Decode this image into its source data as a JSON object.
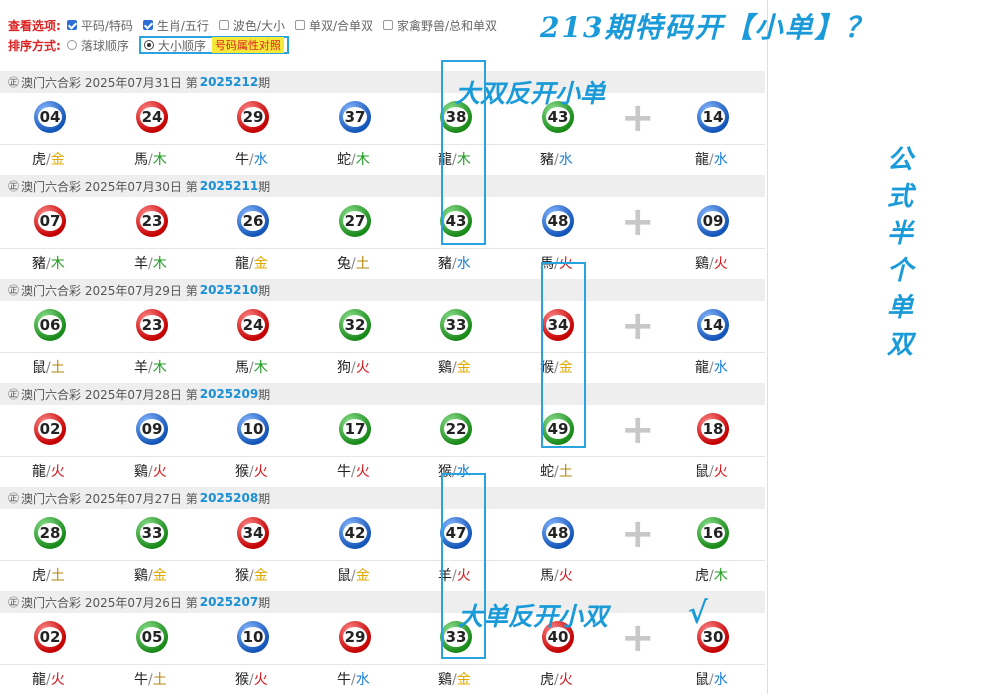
{
  "options": {
    "label": "查看选项:",
    "items": [
      {
        "label": "平码/特码",
        "checked": true
      },
      {
        "label": "生肖/五行",
        "checked": true
      },
      {
        "label": "波色/大小",
        "checked": false
      },
      {
        "label": "单双/合单双",
        "checked": false
      },
      {
        "label": "家禽野兽/总和单双",
        "checked": false
      }
    ]
  },
  "sort": {
    "label": "排序方式:",
    "items": [
      {
        "label": "落球顺序",
        "selected": false
      },
      {
        "label": "大小顺序",
        "selected": true
      }
    ],
    "attr_button": "号码属性对照"
  },
  "draws": [
    {
      "lottery": "澳门六合彩",
      "date": "2025年07月31日",
      "prefix": "第",
      "issue": "2025212",
      "suffix": "期",
      "balls": [
        {
          "n": "04",
          "c": "blue",
          "z": "虎",
          "e": "金",
          "ec": "gold"
        },
        {
          "n": "24",
          "c": "red",
          "z": "馬",
          "e": "木",
          "ec": "wood"
        },
        {
          "n": "29",
          "c": "red",
          "z": "牛",
          "e": "水",
          "ec": "water"
        },
        {
          "n": "37",
          "c": "blue",
          "z": "蛇",
          "e": "木",
          "ec": "wood"
        },
        {
          "n": "38",
          "c": "green",
          "z": "龍",
          "e": "木",
          "ec": "wood"
        },
        {
          "n": "43",
          "c": "green",
          "z": "豬",
          "e": "水",
          "ec": "water"
        }
      ],
      "special": {
        "n": "14",
        "c": "blue",
        "z": "龍",
        "e": "水",
        "ec": "water"
      }
    },
    {
      "lottery": "澳门六合彩",
      "date": "2025年07月30日",
      "prefix": "第",
      "issue": "2025211",
      "suffix": "期",
      "balls": [
        {
          "n": "07",
          "c": "red",
          "z": "豬",
          "e": "木",
          "ec": "wood"
        },
        {
          "n": "23",
          "c": "red",
          "z": "羊",
          "e": "木",
          "ec": "wood"
        },
        {
          "n": "26",
          "c": "blue",
          "z": "龍",
          "e": "金",
          "ec": "gold"
        },
        {
          "n": "27",
          "c": "green",
          "z": "兔",
          "e": "土",
          "ec": "earth"
        },
        {
          "n": "43",
          "c": "green",
          "z": "豬",
          "e": "水",
          "ec": "water"
        },
        {
          "n": "48",
          "c": "blue",
          "z": "馬",
          "e": "火",
          "ec": "fire"
        }
      ],
      "special": {
        "n": "09",
        "c": "blue",
        "z": "鷄",
        "e": "火",
        "ec": "fire"
      }
    },
    {
      "lottery": "澳门六合彩",
      "date": "2025年07月29日",
      "prefix": "第",
      "issue": "2025210",
      "suffix": "期",
      "balls": [
        {
          "n": "06",
          "c": "green",
          "z": "鼠",
          "e": "土",
          "ec": "earth"
        },
        {
          "n": "23",
          "c": "red",
          "z": "羊",
          "e": "木",
          "ec": "wood"
        },
        {
          "n": "24",
          "c": "red",
          "z": "馬",
          "e": "木",
          "ec": "wood"
        },
        {
          "n": "32",
          "c": "green",
          "z": "狗",
          "e": "火",
          "ec": "fire"
        },
        {
          "n": "33",
          "c": "green",
          "z": "鷄",
          "e": "金",
          "ec": "gold"
        },
        {
          "n": "34",
          "c": "red",
          "z": "猴",
          "e": "金",
          "ec": "gold"
        }
      ],
      "special": {
        "n": "14",
        "c": "blue",
        "z": "龍",
        "e": "水",
        "ec": "water"
      }
    },
    {
      "lottery": "澳门六合彩",
      "date": "2025年07月28日",
      "prefix": "第",
      "issue": "2025209",
      "suffix": "期",
      "balls": [
        {
          "n": "02",
          "c": "red",
          "z": "龍",
          "e": "火",
          "ec": "fire"
        },
        {
          "n": "09",
          "c": "blue",
          "z": "鷄",
          "e": "火",
          "ec": "fire"
        },
        {
          "n": "10",
          "c": "blue",
          "z": "猴",
          "e": "火",
          "ec": "fire"
        },
        {
          "n": "17",
          "c": "green",
          "z": "牛",
          "e": "火",
          "ec": "fire"
        },
        {
          "n": "22",
          "c": "green",
          "z": "猴",
          "e": "水",
          "ec": "water"
        },
        {
          "n": "49",
          "c": "green",
          "z": "蛇",
          "e": "土",
          "ec": "earth"
        }
      ],
      "special": {
        "n": "18",
        "c": "red",
        "z": "鼠",
        "e": "火",
        "ec": "fire"
      }
    },
    {
      "lottery": "澳门六合彩",
      "date": "2025年07月27日",
      "prefix": "第",
      "issue": "2025208",
      "suffix": "期",
      "balls": [
        {
          "n": "28",
          "c": "green",
          "z": "虎",
          "e": "土",
          "ec": "earth"
        },
        {
          "n": "33",
          "c": "green",
          "z": "鷄",
          "e": "金",
          "ec": "gold"
        },
        {
          "n": "34",
          "c": "red",
          "z": "猴",
          "e": "金",
          "ec": "gold"
        },
        {
          "n": "42",
          "c": "blue",
          "z": "鼠",
          "e": "金",
          "ec": "gold"
        },
        {
          "n": "47",
          "c": "blue",
          "z": "羊",
          "e": "火",
          "ec": "fire"
        },
        {
          "n": "48",
          "c": "blue",
          "z": "馬",
          "e": "火",
          "ec": "fire"
        }
      ],
      "special": {
        "n": "16",
        "c": "green",
        "z": "虎",
        "e": "木",
        "ec": "wood"
      }
    },
    {
      "lottery": "澳门六合彩",
      "date": "2025年07月26日",
      "prefix": "第",
      "issue": "2025207",
      "suffix": "期",
      "balls": [
        {
          "n": "02",
          "c": "red",
          "z": "龍",
          "e": "火",
          "ec": "fire"
        },
        {
          "n": "05",
          "c": "green",
          "z": "牛",
          "e": "土",
          "ec": "earth"
        },
        {
          "n": "10",
          "c": "blue",
          "z": "猴",
          "e": "火",
          "ec": "fire"
        },
        {
          "n": "29",
          "c": "red",
          "z": "牛",
          "e": "水",
          "ec": "water"
        },
        {
          "n": "33",
          "c": "green",
          "z": "鷄",
          "e": "金",
          "ec": "gold"
        },
        {
          "n": "40",
          "c": "red",
          "z": "虎",
          "e": "火",
          "ec": "fire"
        }
      ],
      "special": {
        "n": "30",
        "c": "red",
        "z": "鼠",
        "e": "水",
        "ec": "water"
      }
    }
  ],
  "overlay": {
    "top_title": "213期特码开【小单】？",
    "note1": "大双反开小单",
    "note2": "大单反开小双",
    "check_mark": "√",
    "vertical_text": [
      "公",
      "式",
      "半",
      "个",
      "单",
      "双"
    ]
  },
  "colors": {
    "accent": "#1a9ad8",
    "red": "#c40000",
    "blue": "#1456b8",
    "green": "#198a19"
  }
}
